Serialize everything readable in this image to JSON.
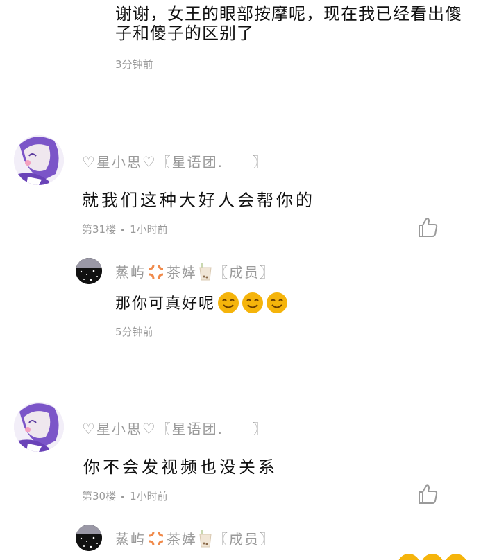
{
  "top_reply": {
    "text": "谢谢，女王的眼部按摩呢，现在我已经看出傻子和傻子的区别了",
    "time": "3分钟前"
  },
  "comments": [
    {
      "username": "星小思",
      "group_open": "〖星语团.",
      "group_close": "〗",
      "text": "就我们这种大好人会帮你的",
      "floor": "第31楼",
      "time": "1小时前",
      "reply": {
        "name_part1": "蒸屿",
        "name_part2": "茶婞",
        "role": "〖成员〗",
        "text": "那你可真好呢",
        "time": "5分钟前"
      }
    },
    {
      "username": "星小思",
      "group_open": "〖星语团.",
      "group_close": "〗",
      "text": "你不会发视频也没关系",
      "floor": "第30楼",
      "time": "1小时前",
      "reply": {
        "name_part1": "蒸屿",
        "name_part2": "茶婞",
        "role": "〖成员〗"
      }
    }
  ],
  "icons": {
    "like": "thumbs-up-icon",
    "heart": "heart-outline-icon",
    "anger": "anger-symbol-icon",
    "cup": "bubble-tea-cup-icon",
    "smile": "smiling-face-icon"
  },
  "colors": {
    "text": "#111111",
    "muted": "#9a9a9a",
    "divider": "#e6e6e6",
    "emoji": "#f5b40b"
  }
}
